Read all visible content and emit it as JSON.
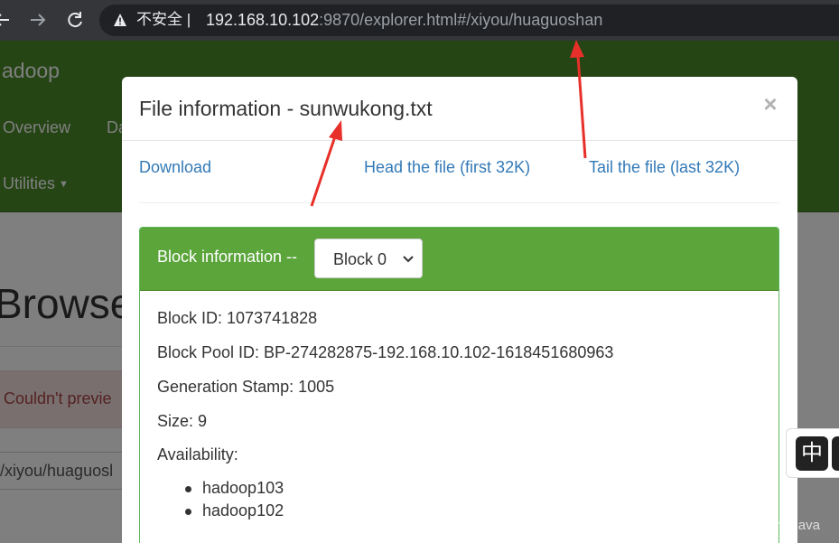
{
  "browser": {
    "back_icon": "back-arrow-icon",
    "forward_icon": "forward-arrow-icon",
    "reload_icon": "reload-icon",
    "warning_icon": "warning-triangle-icon",
    "security_label": "不安全",
    "url_host": "192.168.10.102",
    "url_rest": ":9870/explorer.html#/xiyou/huaguoshan"
  },
  "navbar": {
    "brand": "adoop",
    "items": [
      {
        "label": "Overview"
      },
      {
        "label": "Da"
      },
      {
        "label": "Utilities"
      }
    ]
  },
  "page": {
    "heading": "Browse",
    "alert": "Couldn't previe",
    "path_value": "/xiyou/huaguosl"
  },
  "modal": {
    "title": "File information - sunwukong.txt",
    "close_label": "×",
    "links": {
      "download": "Download",
      "head": "Head the file (first 32K)",
      "tail": "Tail the file (last 32K)"
    },
    "block": {
      "heading": "Block information --",
      "selected": "Block 0",
      "block_id": "Block ID: 1073741828",
      "block_pool_id": "Block Pool ID: BP-274282875-192.168.10.102-1618451680963",
      "generation_stamp": "Generation Stamp: 1005",
      "size": "Size: 9",
      "availability_label": "Availability:",
      "hosts": [
        "hadoop103",
        "hadoop102"
      ]
    }
  },
  "ime": {
    "label": "中"
  },
  "watermark": "https://blog.csdn.net/grd_java",
  "colors": {
    "navbar": "#4a8a2a",
    "panel_header": "#5ba53b",
    "link": "#337ab7",
    "arrow": "#e8302a"
  }
}
